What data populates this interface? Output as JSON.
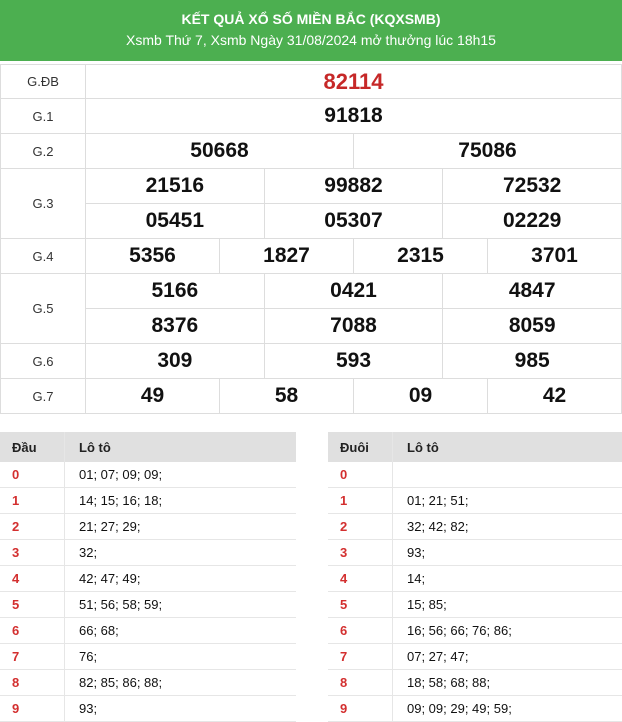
{
  "header": {
    "title": "KẾT QUẢ XỔ SỐ MIỀN BẮC (KQXSMB)",
    "subtitle": "Xsmb Thứ 7, Xsmb Ngày 31/08/2024 mở thưởng lúc 18h15"
  },
  "prizes": {
    "gdb": {
      "label": "G.ĐB",
      "numbers": [
        "82114"
      ]
    },
    "g1": {
      "label": "G.1",
      "numbers": [
        "91818"
      ]
    },
    "g2": {
      "label": "G.2",
      "numbers": [
        "50668",
        "75086"
      ]
    },
    "g3": {
      "label": "G.3",
      "numbers": [
        "21516",
        "99882",
        "72532",
        "05451",
        "05307",
        "02229"
      ]
    },
    "g4": {
      "label": "G.4",
      "numbers": [
        "5356",
        "1827",
        "2315",
        "3701"
      ]
    },
    "g5": {
      "label": "G.5",
      "numbers": [
        "5166",
        "0421",
        "4847",
        "8376",
        "7088",
        "8059"
      ]
    },
    "g6": {
      "label": "G.6",
      "numbers": [
        "309",
        "593",
        "985"
      ]
    },
    "g7": {
      "label": "G.7",
      "numbers": [
        "49",
        "58",
        "09",
        "42"
      ]
    }
  },
  "dau_table": {
    "header_key": "Đầu",
    "header_value": "Lô tô",
    "rows": [
      {
        "key": "0",
        "value": "01; 07; 09; 09;"
      },
      {
        "key": "1",
        "value": "14; 15; 16; 18;"
      },
      {
        "key": "2",
        "value": "21; 27; 29;"
      },
      {
        "key": "3",
        "value": "32;"
      },
      {
        "key": "4",
        "value": "42; 47; 49;"
      },
      {
        "key": "5",
        "value": "51; 56; 58; 59;"
      },
      {
        "key": "6",
        "value": "66; 68;"
      },
      {
        "key": "7",
        "value": "76;"
      },
      {
        "key": "8",
        "value": "82; 85; 86; 88;"
      },
      {
        "key": "9",
        "value": "93;"
      }
    ]
  },
  "duoi_table": {
    "header_key": "Đuôi",
    "header_value": "Lô tô",
    "rows": [
      {
        "key": "0",
        "value": ""
      },
      {
        "key": "1",
        "value": "01; 21; 51;"
      },
      {
        "key": "2",
        "value": "32; 42; 82;"
      },
      {
        "key": "3",
        "value": "93;"
      },
      {
        "key": "4",
        "value": "14;"
      },
      {
        "key": "5",
        "value": "15; 85;"
      },
      {
        "key": "6",
        "value": "16; 56; 66; 76; 86;"
      },
      {
        "key": "7",
        "value": "07; 27; 47;"
      },
      {
        "key": "8",
        "value": "18; 58; 68; 88;"
      },
      {
        "key": "9",
        "value": "09; 09; 29; 49; 59;"
      }
    ]
  }
}
